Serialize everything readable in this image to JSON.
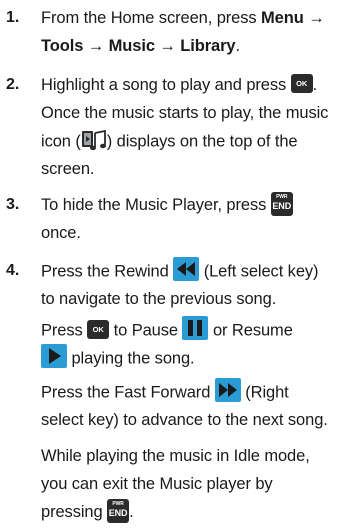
{
  "steps": [
    {
      "number": "1.",
      "line1_pre": "From the Home screen, press ",
      "line1_bold": "Menu →",
      "line2_bold": "Tools → Music → Library",
      "line2_post": "."
    },
    {
      "number": "2.",
      "line1_pre": "Highlight a song to play and press",
      "line1_key": "OK",
      "line1_post": ".",
      "line2": "Once the music starts to play, the music",
      "line3_pre": "icon (",
      "line3_post": ") displays on the top of the",
      "line4": "screen."
    },
    {
      "number": "3.",
      "line1_pre": "To hide the Music Player, press",
      "line1_key_top": "PWR",
      "line1_key_bottom": "END",
      "line2": "once."
    },
    {
      "number": "4.",
      "line1_pre": "Press the Rewind",
      "line1_post": "(Left select key)",
      "line2": "to navigate to the previous song.",
      "line3_pre": "Press",
      "line3_key": "OK",
      "line3_mid": "to Pause",
      "line3_post": "or Resume",
      "line4_post": "playing the song.",
      "line5_pre": "Press the Fast Forward",
      "line5_post": "(Right",
      "line6": "select key) to advance to the next song.",
      "line7": "While playing the music in Idle mode,",
      "line8": "you can exit the Music player by",
      "line9_pre": "pressing",
      "line9_key_top": "PWR",
      "line9_key_bottom": "END",
      "line9_post": "."
    }
  ],
  "icons": {
    "music_icon": "music-note-icon",
    "rewind_icon": "rewind-icon",
    "pause_icon": "pause-icon",
    "play_icon": "play-icon",
    "fast_forward_icon": "fast-forward-icon"
  },
  "colors": {
    "icon_blue": "#2b9bd6",
    "key_dark": "#2b2b2b",
    "text": "#1a1a1a"
  }
}
